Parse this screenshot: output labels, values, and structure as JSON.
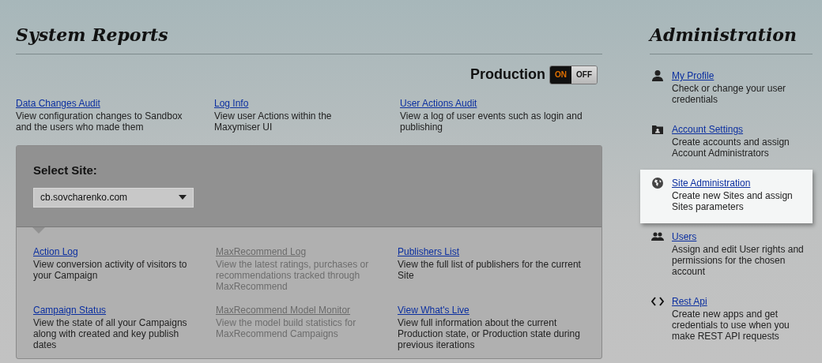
{
  "reports": {
    "title": "System Reports",
    "production": {
      "label": "Production",
      "on": true,
      "on_label": "ON",
      "off_label": "OFF"
    },
    "links": [
      {
        "title": "Data Changes Audit",
        "description": "View configuration changes to Sandbox and the users who made them"
      },
      {
        "title": "Log Info",
        "description": "View user Actions within the Maxymiser UI"
      },
      {
        "title": "User Actions Audit",
        "description": "View a log of user events such as login and publishing"
      }
    ]
  },
  "site_panel": {
    "label": "Select Site:",
    "site": "cb.sovcharenko.com",
    "links": [
      {
        "title": "Action Log",
        "description": "View conversion activity of visitors to your Campaign",
        "disabled": false
      },
      {
        "title": "MaxRecommend Log",
        "description": "View the latest ratings, purchases or recommendations tracked through MaxRecommend",
        "disabled": true
      },
      {
        "title": "Publishers List",
        "description": "View the full list of publishers for the current Site",
        "disabled": false
      },
      {
        "title": "Campaign Status",
        "description": "View the state of all your Campaigns along with created and key publish dates",
        "disabled": false
      },
      {
        "title": "MaxRecommend Model Monitor",
        "description": "View the model build statistics for MaxRecommend Campaigns",
        "disabled": true
      },
      {
        "title": "View What's Live",
        "description": "View full information about the current Production state, or Production state during previous iterations",
        "disabled": false
      }
    ]
  },
  "administration": {
    "title": "Administration",
    "items": [
      {
        "kind": "profile",
        "title": "My Profile",
        "description": "Check or change your user credentials",
        "selected": false
      },
      {
        "kind": "account",
        "title": "Account Settings",
        "description": "Create accounts and assign Account Administrators",
        "selected": false
      },
      {
        "kind": "site",
        "title": "Site Administration",
        "description": "Create new Sites and assign Sites parameters",
        "selected": true
      },
      {
        "kind": "users",
        "title": "Users",
        "description": "Assign and edit User rights and permissions for the chosen account",
        "selected": false
      },
      {
        "kind": "api",
        "title": "Rest Api",
        "description": "Create new apps and get credentials to use when you make REST API requests",
        "selected": false
      }
    ]
  }
}
